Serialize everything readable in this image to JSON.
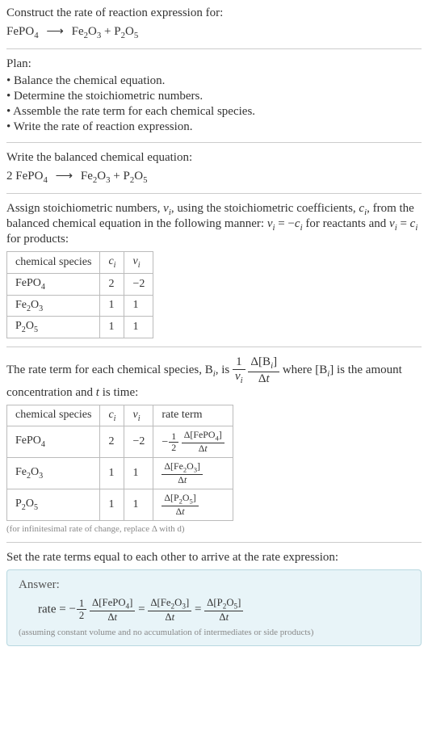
{
  "intro": {
    "text": "Construct the rate of reaction expression for:"
  },
  "plan": {
    "heading": "Plan:",
    "b1": "• Balance the chemical equation.",
    "b2": "• Determine the stoichiometric numbers.",
    "b3": "• Assemble the rate term for each chemical species.",
    "b4": "• Write the rate of reaction expression."
  },
  "balanced": {
    "heading": "Write the balanced chemical equation:"
  },
  "assign": {
    "text1": "Assign stoichiometric numbers, ",
    "text2": ", using the stoichiometric coefficients, ",
    "text3": ", from the balanced chemical equation in the following manner: ",
    "text4": " for reactants and ",
    "text5": " for products:"
  },
  "table1": {
    "h1": "chemical species",
    "h2": "cᵢ",
    "h3": "νᵢ",
    "r1c1": "FePO₄",
    "r1c2": "2",
    "r1c3": "−2",
    "r2c1": "Fe₂O₃",
    "r2c2": "1",
    "r2c3": "1",
    "r3c1": "P₂O₅",
    "r3c2": "1",
    "r3c3": "1"
  },
  "rateterm": {
    "text1": "The rate term for each chemical species, ",
    "text2": ", is ",
    "text3": " where ",
    "text4": " is the amount concentration and ",
    "text5": " is time:"
  },
  "table2": {
    "h1": "chemical species",
    "h2": "cᵢ",
    "h3": "νᵢ",
    "h4": "rate term",
    "r1c2": "2",
    "r1c3": "−2",
    "r2c2": "1",
    "r2c3": "1",
    "r3c2": "1",
    "r3c3": "1"
  },
  "footnote": "(for infinitesimal rate of change, replace Δ with d)",
  "setequal": "Set the rate terms equal to each other to arrive at the rate expression:",
  "answer": {
    "label": "Answer:",
    "ratelabel": "rate = ",
    "note": "(assuming constant volume and no accumulation of intermediates or side products)"
  },
  "chart_data": {
    "type": "table",
    "title": "Stoichiometric rate of reaction",
    "unbalanced_equation": "FePO4 → Fe2O3 + P2O5",
    "balanced_equation": "2 FePO4 → Fe2O3 + P2O5",
    "species": [
      {
        "name": "FePO4",
        "c_i": 2,
        "nu_i": -2,
        "rate_term": "-(1/2) Δ[FePO4]/Δt"
      },
      {
        "name": "Fe2O3",
        "c_i": 1,
        "nu_i": 1,
        "rate_term": "Δ[Fe2O3]/Δt"
      },
      {
        "name": "P2O5",
        "c_i": 1,
        "nu_i": 1,
        "rate_term": "Δ[P2O5]/Δt"
      }
    ],
    "rate_expression": "rate = -(1/2) Δ[FePO4]/Δt = Δ[Fe2O3]/Δt = Δ[P2O5]/Δt"
  }
}
